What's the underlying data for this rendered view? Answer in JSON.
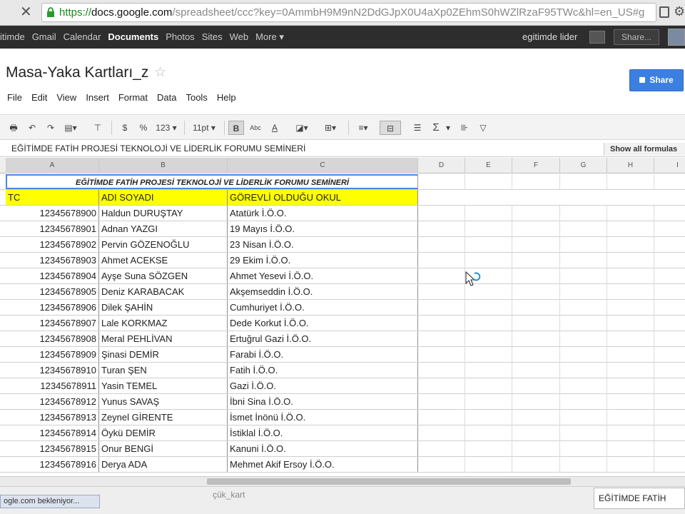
{
  "browser": {
    "url_protocol": "https://",
    "url_host": "docs.google.com",
    "url_path": "/spreadsheet/ccc?key=0AmmbH9M9nN2DdGJpX0U4aXp0ZEhmS0hWZlRzaF95TWc&hl=en_US#g"
  },
  "gbar": {
    "links": [
      "itimde",
      "Gmail",
      "Calendar",
      "Documents",
      "Photos",
      "Sites",
      "Web",
      "More ▾"
    ],
    "active": "Documents",
    "user": "egitimde lider",
    "share_label": "Share..."
  },
  "doc": {
    "title": "Masa-Yaka Kartları_z",
    "share_label": "Share"
  },
  "menu": [
    "File",
    "Edit",
    "View",
    "Insert",
    "Format",
    "Data",
    "Tools",
    "Help"
  ],
  "toolbar": {
    "currency": "$",
    "percent": "%",
    "number_format": "123 ▾",
    "font_size": "11pt ▾",
    "bold": "B",
    "strike": "Abc",
    "text_color": "A",
    "sum": "Σ"
  },
  "formula_bar": {
    "content": "EĞİTİMDE FATİH PROJESİ TEKNOLOJİ VE LİDERLİK FORUMU SEMİNERİ",
    "show_formulas": "Show all formulas"
  },
  "columns": [
    "A",
    "B",
    "C",
    "D",
    "E",
    "F",
    "G",
    "H",
    "I"
  ],
  "sheet": {
    "title": "EĞİTİMDE FATİH PROJESİ TEKNOLOJİ VE LİDERLİK FORUMU SEMİNERİ",
    "headers": [
      "TC",
      "ADI SOYADI",
      "GÖREVLİ OLDUĞU OKUL"
    ],
    "rows": [
      [
        "12345678900",
        "Haldun DURUŞTAY",
        "Atatürk İ.Ö.O."
      ],
      [
        "12345678901",
        "Adnan YAZGI",
        "19 Mayıs İ.Ö.O."
      ],
      [
        "12345678902",
        "Pervin GÖZENOĞLU",
        "23 Nisan İ.Ö.O."
      ],
      [
        "12345678903",
        "Ahmet ACEKSE",
        "29 Ekim İ.Ö.O."
      ],
      [
        "12345678904",
        "Ayşe Suna SÖZGEN",
        "Ahmet Yesevi İ.Ö.O."
      ],
      [
        "12345678905",
        "Deniz KARABACAK",
        "Akşemseddin İ.Ö.O."
      ],
      [
        "12345678906",
        "Dilek ŞAHİN",
        "Cumhuriyet İ.Ö.O."
      ],
      [
        "12345678907",
        "Lale KORKMAZ",
        "Dede Korkut İ.Ö.O."
      ],
      [
        "12345678908",
        "Meral PEHLİVAN",
        "Ertuğrul Gazi İ.Ö.O."
      ],
      [
        "12345678909",
        "Şinasi DEMİR",
        "Farabi İ.Ö.O."
      ],
      [
        "12345678910",
        "Turan ŞEN",
        "Fatih İ.Ö.O."
      ],
      [
        "12345678911",
        "Yasin TEMEL",
        "Gazi İ.Ö.O."
      ],
      [
        "12345678912",
        "Yunus SAVAŞ",
        "İbni Sina İ.Ö.O."
      ],
      [
        "12345678913",
        "Zeynel GİRENTE",
        "İsmet İnönü İ.Ö.O."
      ],
      [
        "12345678914",
        "Öykü DEMİR",
        "İstiklal İ.Ö.O."
      ],
      [
        "12345678915",
        "Onur BENGİ",
        "Kanuni İ.Ö.O."
      ],
      [
        "12345678916",
        "Derya ADA",
        "Mehmet Akif Ersoy İ.Ö.O."
      ]
    ]
  },
  "status": {
    "text": "ogle.com bekleniyor...",
    "tab_peek": "çük_kart",
    "active_tab": "EĞİTİMDE FATİH"
  },
  "colors": {
    "header_fill": "#ffff00",
    "share_blue": "#3b7fe0",
    "gbar_bg": "#2d2d2d"
  }
}
